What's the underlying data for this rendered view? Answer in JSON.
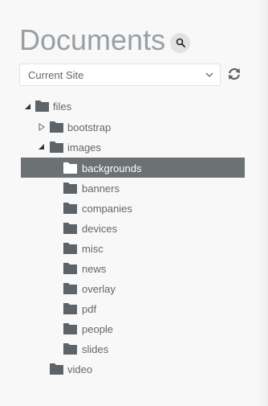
{
  "header": {
    "title": "Documents",
    "search_icon": "search-icon"
  },
  "site_select": {
    "value": "Current Site",
    "chevron_icon": "chevron-down-icon"
  },
  "refresh_icon": "refresh-icon",
  "tree": {
    "root": {
      "label": "files",
      "state": "expanded"
    },
    "level1": [
      {
        "label": "bootstrap",
        "state": "collapsed"
      },
      {
        "label": "images",
        "state": "expanded"
      },
      {
        "label": "video",
        "state": "leaf"
      }
    ],
    "images_children": [
      {
        "label": "backgrounds",
        "selected": true
      },
      {
        "label": "banners"
      },
      {
        "label": "companies"
      },
      {
        "label": "devices"
      },
      {
        "label": "misc"
      },
      {
        "label": "news"
      },
      {
        "label": "overlay"
      },
      {
        "label": "pdf"
      },
      {
        "label": "people"
      },
      {
        "label": "slides"
      }
    ]
  },
  "colors": {
    "title": "#9a9fa3",
    "folder": "#5d6366",
    "selected_row": "#6c7174",
    "selected_text": "#ffffff"
  }
}
